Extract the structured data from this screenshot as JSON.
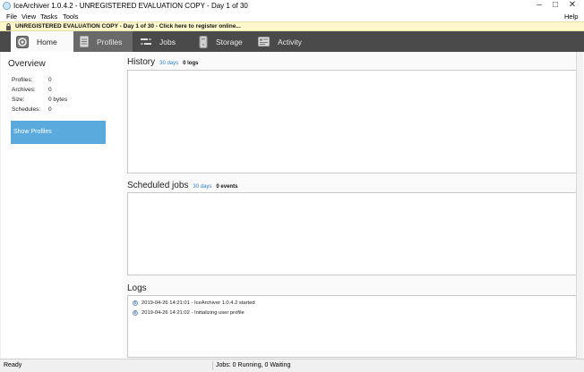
{
  "window": {
    "title": "IceArchiver 1.0.4.2 - UNREGISTERED EVALUATION COPY - Day 1 of 30",
    "minimize_glyph": "–",
    "maximize_glyph": "□",
    "close_glyph": "✕"
  },
  "menu": {
    "file": "File",
    "view": "View",
    "tasks": "Tasks",
    "tools": "Tools",
    "help": "Help"
  },
  "banner": {
    "text": "UNREGISTERED EVALUATION COPY - Day 1 of 30 - Click here to register online..."
  },
  "nav": {
    "tabs": [
      {
        "label": "Home",
        "icon": "gear-icon"
      },
      {
        "label": "Profiles",
        "icon": "document-icon"
      },
      {
        "label": "Jobs",
        "icon": "jobs-icon"
      },
      {
        "label": "Storage",
        "icon": "storage-icon"
      },
      {
        "label": "Activity",
        "icon": "activity-icon"
      }
    ],
    "active": "Home"
  },
  "overview": {
    "title": "Overview",
    "stats": [
      {
        "label": "Profiles:",
        "value": "0"
      },
      {
        "label": "Archives:",
        "value": "0"
      },
      {
        "label": "Size:",
        "value": "0 bytes"
      },
      {
        "label": "Schedules:",
        "value": "0"
      }
    ],
    "show_profiles": "Show Profiles"
  },
  "history": {
    "title": "History",
    "range": "30 days",
    "count": "0 logs"
  },
  "scheduled": {
    "title": "Scheduled jobs",
    "range": "30 days",
    "count": "0 events"
  },
  "logs": {
    "title": "Logs",
    "entries": [
      {
        "text": "2019-04-26 14:21:01 - IceArchiver 1.0.4.2 started"
      },
      {
        "text": "2019-04-26 14:21:02 - Initializing user profile"
      }
    ]
  },
  "status": {
    "ready": "Ready",
    "jobs": "Jobs: 0 Running, 0 Waiting"
  },
  "colors": {
    "accent": "#5aaade",
    "link": "#2f7fc8",
    "nav_bg": "#4a4a4a",
    "banner_bg": "#fff7cc"
  }
}
